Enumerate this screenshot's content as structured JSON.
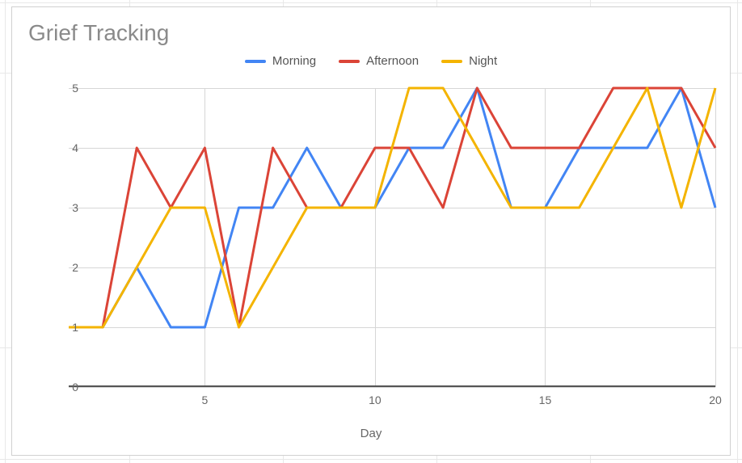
{
  "chart_data": {
    "type": "line",
    "title": "Grief Tracking",
    "xlabel": "Day",
    "ylabel": "",
    "x": [
      1,
      2,
      3,
      4,
      5,
      6,
      7,
      8,
      9,
      10,
      11,
      12,
      13,
      14,
      15,
      16,
      17,
      18,
      19,
      20
    ],
    "x_ticks": [
      5,
      10,
      15,
      20
    ],
    "y_ticks": [
      0,
      1,
      2,
      3,
      4,
      5
    ],
    "ylim": [
      0,
      5
    ],
    "xlim": [
      1,
      20
    ],
    "series": [
      {
        "name": "Morning",
        "color": "#4285F4",
        "values": [
          1,
          1,
          2,
          1,
          1,
          3,
          3,
          4,
          3,
          3,
          4,
          4,
          5,
          3,
          3,
          4,
          4,
          4,
          5,
          3
        ]
      },
      {
        "name": "Afternoon",
        "color": "#DB4437",
        "values": [
          1,
          1,
          4,
          3,
          4,
          1,
          4,
          3,
          3,
          4,
          4,
          3,
          5,
          4,
          4,
          4,
          5,
          5,
          5,
          4
        ]
      },
      {
        "name": "Night",
        "color": "#F4B400",
        "values": [
          1,
          1,
          2,
          3,
          3,
          1,
          2,
          3,
          3,
          3,
          5,
          5,
          4,
          3,
          3,
          3,
          4,
          5,
          3,
          5
        ]
      }
    ]
  }
}
